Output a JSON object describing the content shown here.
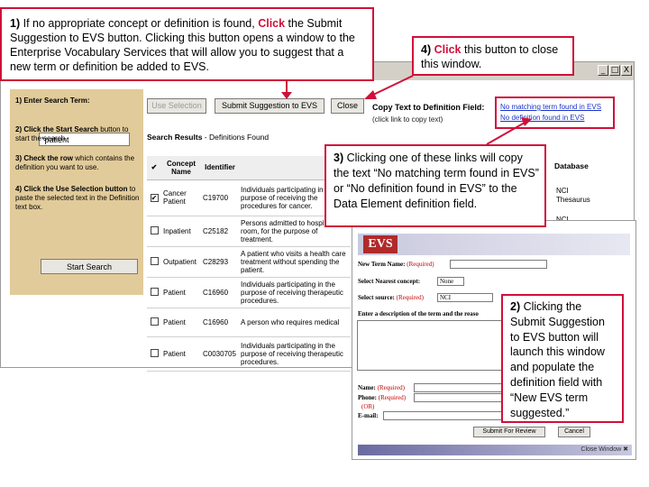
{
  "callouts": {
    "c1": {
      "num": "1)",
      "t1": " If no appropriate concept or definition is found, ",
      "click": "Click",
      "t2": " the Submit Suggestion to EVS button. Clicking this button opens a window to the Enterprise Vocabulary Services that will allow you to suggest that a new term or definition be added to EVS."
    },
    "c4": {
      "num": "4)",
      "click": "Click",
      "t2": " this button to close this window."
    },
    "c3": {
      "num": "3)",
      "t1": " Clicking one of these links will copy the text “No matching term found in EVS” or “No definition found in EVS” to the Data Element definition field."
    },
    "c2": {
      "num": "2)",
      "t1": " Clicking the Submit Suggestion to EVS button will launch this window and populate the definition field with “New EVS term suggested.”"
    }
  },
  "window": {
    "buttons": [
      "_",
      "□",
      "X"
    ]
  },
  "left_panel": {
    "step1": "1) Enter Search Term:",
    "search_value": "*patient",
    "step2_bold": "2) Click the Start Search",
    "step2_rest": "button to start the search.",
    "step3_bold": "3) Check the row",
    "step3_rest": "which contains the definition you want to use.",
    "step4_bold": "4) Click the Use Selection button",
    "step4_rest": "to paste the selected text in the Definition text box.",
    "start_search": "Start Search"
  },
  "toolbar": {
    "use_selection": "Use Selection",
    "submit_suggestion": "Submit Suggestion to EVS",
    "close": "Close"
  },
  "copy_text": {
    "title": "Copy Text to Definition Field:",
    "subtitle": "(click link to copy text)",
    "link1": "No matching term found in EVS",
    "link2": "No definition found in EVS"
  },
  "results": {
    "title_bold": "Search Results",
    "title_rest": " - Definitions Found",
    "headers": {
      "check": "✔",
      "concept": "Concept Name",
      "identifier": "Identifier",
      "database": "Database"
    },
    "rows": [
      {
        "checked": "✔",
        "concept": "Cancer Patient",
        "id": "C19700",
        "def": "Individuals participating in the purpose of receiving the procedures for cancer."
      },
      {
        "checked": "",
        "concept": "Inpatient",
        "id": "C25182",
        "def": "Persons admitted to hospital room, for the purpose of treatment."
      },
      {
        "checked": "",
        "concept": "Outpatient",
        "id": "C28293",
        "def": "A patient who visits a health care treatment without spending the patient."
      },
      {
        "checked": "",
        "concept": "Patient",
        "id": "C16960",
        "def": "Individuals participating in the purpose of receiving therapeutic procedures."
      },
      {
        "checked": "",
        "concept": "Patient",
        "id": "C16960",
        "def": "A person who requires medical"
      },
      {
        "checked": "",
        "concept": "Patient",
        "id": "C0030705",
        "def": "Individuals participating in the purpose of receiving therapeutic procedures."
      }
    ],
    "db1": "NCI Thesaurus",
    "db2": "NCI"
  },
  "popup": {
    "logo": "EVS",
    "new_term_label": "New Term Name:",
    "required": "(Required)",
    "nearest_label": "Select Nearest concept:",
    "nearest_value": "None",
    "source_label": "Select source:",
    "source_value": "NCI",
    "describe_label": "Enter a description of the term and the reaso",
    "name_label": "Name:",
    "phone_label": "Phone:",
    "or": "(OR)",
    "email_label": "E-mail:",
    "submit_btn": "Submit For Review",
    "cancel_btn": "Cancel",
    "close_window": "Close Window"
  },
  "colors": {
    "accent": "#d0103a",
    "panel": "#e2cb9a",
    "link": "#1a33cc"
  }
}
